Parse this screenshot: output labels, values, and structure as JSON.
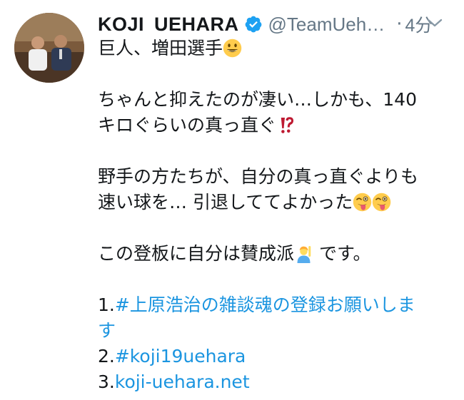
{
  "user": {
    "display_name": "KOJI UEHARA",
    "handle": "@TeamUeh…",
    "time": "4分",
    "separator": "·"
  },
  "tweet": {
    "line1": "巨人、増田選手",
    "line2": "ちゃんと抑えたのが凄い…しかも、140",
    "line3": "キロぐらいの真っ直ぐ",
    "line4": "野手の方たちが、自分の真っ直ぐよりも",
    "line5": "速い球を… 引退しててよかった",
    "line6a": "この登板に自分は賛成派",
    "line6b": " です。",
    "list1_num": "1.",
    "list1_link_a": "#上原浩治の雑談魂の登録お願いしま",
    "list1_link_b": "す",
    "list2_num": "2.",
    "list2_link": "#koji19uehara",
    "list3_num": "3.",
    "list3_link": "koji-uehara.net"
  },
  "icons": {
    "verified": "verified-badge-icon",
    "caret": "chevron-down-icon",
    "emoji_grin": "grinning-face-emoji",
    "emoji_interrobang": "interrobang-emoji",
    "emoji_wink_tongue": "winking-face-with-tongue-emoji",
    "emoji_raising_hand": "person-raising-hand-emoji"
  },
  "colors": {
    "link": "#1b95e0",
    "secondary_text": "#657786",
    "verified": "#1da1f2"
  }
}
